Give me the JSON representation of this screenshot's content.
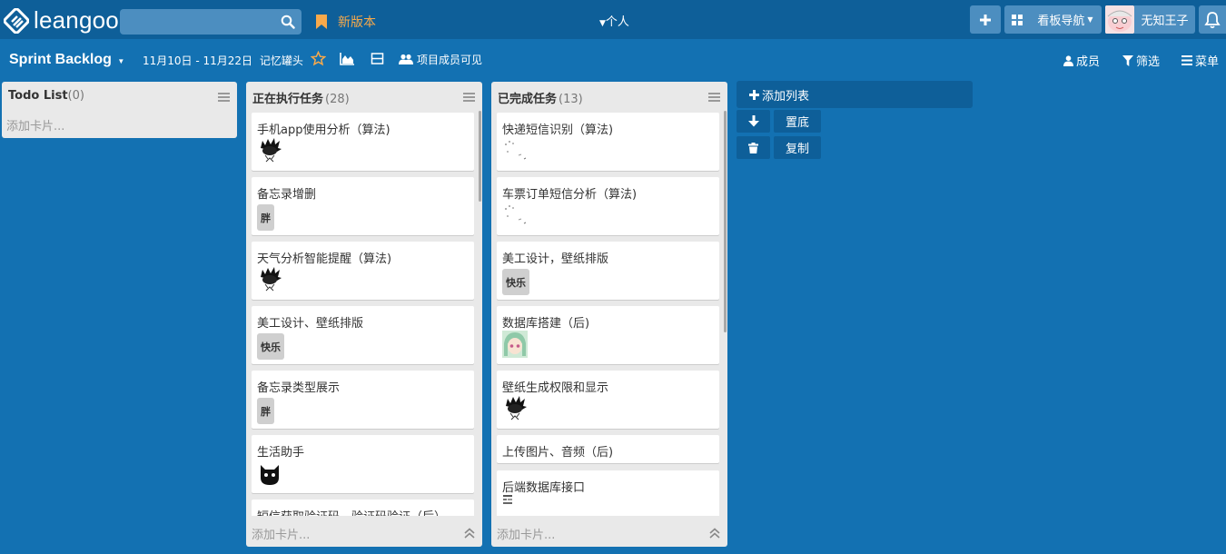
{
  "topbar": {
    "logo_text": "leangoo",
    "search_placeholder": "",
    "new_version_label": "新版本",
    "personal_label": "个人",
    "board_nav_label": "看板导航",
    "username": "无知王子"
  },
  "board": {
    "title": "Sprint Backlog",
    "date_range": "11月10日 - 11月22日",
    "tag": "记忆罐头",
    "visibility": "项目成员可见",
    "members_label": "成员",
    "filter_label": "筛选",
    "menu_label": "菜单"
  },
  "lists": [
    {
      "title": "Todo List",
      "count": "(0)",
      "add_card": "添加卡片...",
      "cards": []
    },
    {
      "title": "正在执行任务",
      "count": "(28)",
      "add_card": "添加卡片...",
      "cards": [
        {
          "title": "手机app使用分析（算法)",
          "avatar": "spiky-hair-avatar"
        },
        {
          "title": "备忘录增删",
          "label": "胖"
        },
        {
          "title": "天气分析智能提醒（算法)",
          "avatar": "spiky-hair-avatar"
        },
        {
          "title": "美工设计、壁纸排版",
          "label": "快乐"
        },
        {
          "title": "备忘录类型展示",
          "label": "胖"
        },
        {
          "title": "生活助手",
          "avatar": "black-cat-avatar"
        },
        {
          "title": "短信获取验证码，验证码验证（后）"
        }
      ]
    },
    {
      "title": "已完成任务",
      "count": "(13)",
      "add_card": "添加卡片...",
      "cards": [
        {
          "title": "快递短信识别（算法)",
          "avatar": "sketch-avatar"
        },
        {
          "title": "车票订单短信分析（算法)",
          "avatar": "sketch-avatar"
        },
        {
          "title": "美工设计，壁纸排版",
          "label": "快乐"
        },
        {
          "title": "数据库搭建（后)",
          "avatar": "anime-avatar"
        },
        {
          "title": "壁纸生成权限和显示",
          "avatar": "spiky-hair-avatar"
        },
        {
          "title": "上传图片、音频（后)"
        },
        {
          "title": "后端数据库接口",
          "avatar": "small-icon-avatar"
        }
      ]
    }
  ],
  "side_panel": {
    "add_list_label": "添加列表",
    "bottom_label": "置底",
    "copy_label": "复制"
  },
  "colors": {
    "background": "#1371b2",
    "topbar": "#0e5f99",
    "accent_orange": "#f7a94b"
  }
}
